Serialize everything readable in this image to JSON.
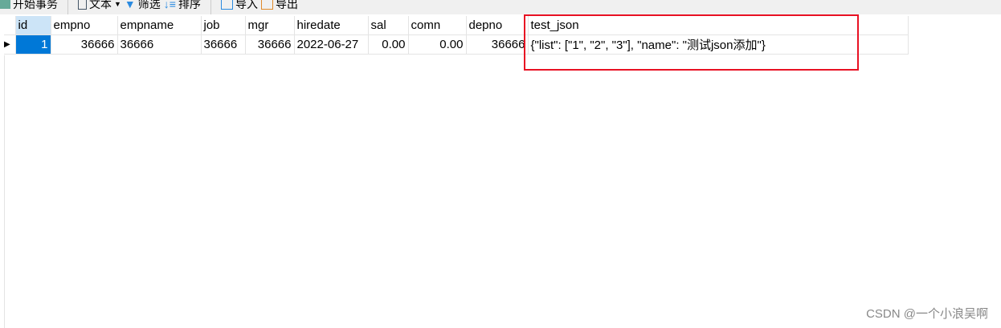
{
  "toolbar": {
    "begin": "开始事务",
    "text": "文本",
    "filter": "筛选",
    "sort": "排序",
    "import": "导入",
    "export": "导出"
  },
  "columns": [
    "id",
    "empno",
    "empname",
    "job",
    "mgr",
    "hiredate",
    "sal",
    "comn",
    "depno",
    "test_json"
  ],
  "rows": [
    [
      "1",
      "36666",
      "36666",
      "36666",
      "36666",
      "2022-06-27",
      "0.00",
      "0.00",
      "36666",
      "{\"list\": [\"1\", \"2\", \"3\"], \"name\": \"测试json添加\"}"
    ]
  ],
  "watermark": "CSDN @一个小浪吴啊"
}
